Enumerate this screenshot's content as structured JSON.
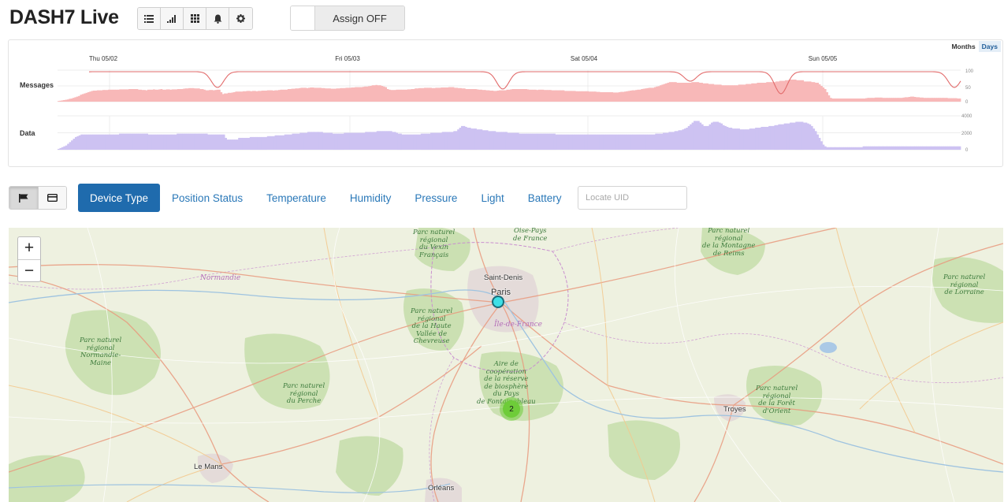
{
  "header": {
    "title": "DASH7 Live",
    "toolbar_icons": [
      "list-icon",
      "signal-icon",
      "grid-icon",
      "bell-icon",
      "gear-icon"
    ],
    "assign_label": "Assign OFF"
  },
  "chart": {
    "range_toggle": {
      "options": [
        "Months",
        "Days"
      ],
      "selected": "Days"
    },
    "day_labels": [
      "Thu 05/02",
      "Fri 05/03",
      "Sat 05/04",
      "Sun 05/05"
    ],
    "messages": {
      "label": "Messages",
      "ticks": [
        "100",
        "50",
        "0"
      ],
      "color": "#f8b8b8",
      "line_color": "#e26b6b"
    },
    "data": {
      "label": "Data",
      "ticks": [
        "4000",
        "2000",
        "0"
      ],
      "color": "#cdc2f2"
    }
  },
  "chart_data": [
    {
      "type": "bar",
      "name": "Messages",
      "x_labels": [
        "Thu 05/02",
        "Fri 05/03",
        "Sat 05/04",
        "Sun 05/05"
      ],
      "ylim": [
        0,
        100
      ],
      "values": [
        2,
        3,
        4,
        5,
        6,
        7,
        9,
        10,
        12,
        14,
        16,
        18,
        22,
        24,
        26,
        28,
        30,
        32,
        34,
        35,
        35,
        36,
        36,
        36,
        37,
        37,
        37,
        38,
        38,
        38,
        38,
        38,
        38,
        39,
        39,
        39,
        39,
        39,
        40,
        40,
        40,
        40,
        40,
        38,
        38,
        37,
        37,
        36,
        38,
        38,
        38,
        39,
        38,
        38,
        39,
        40,
        38,
        38,
        39,
        39,
        38,
        39,
        39,
        39,
        40,
        40,
        40,
        41,
        42,
        42,
        43,
        43,
        43,
        42,
        42,
        42,
        40,
        40,
        38,
        36,
        36,
        37,
        37,
        36,
        37,
        38,
        38,
        30,
        24,
        26,
        26,
        28,
        28,
        29,
        30,
        32,
        32,
        32,
        32,
        33,
        33,
        34,
        34,
        33,
        34,
        34,
        33,
        34,
        34,
        35,
        35,
        35,
        36,
        36,
        36,
        35,
        36,
        36,
        37,
        38,
        38,
        38,
        38,
        40,
        40,
        41,
        41,
        42,
        42,
        43,
        44,
        44,
        44,
        43,
        44,
        45,
        45,
        44,
        44,
        44,
        44,
        43,
        43,
        42,
        42,
        42,
        41,
        41,
        41,
        42,
        42,
        43,
        43,
        43,
        44,
        44,
        44,
        45,
        45,
        46,
        46,
        46,
        46,
        47,
        48,
        48,
        49,
        50,
        52,
        52,
        53,
        52,
        52,
        50,
        48,
        46,
        40,
        38,
        37,
        37,
        37,
        38,
        38,
        38,
        38,
        38,
        38,
        39,
        39,
        40,
        40,
        42,
        42,
        43,
        43,
        43,
        44,
        44,
        44,
        44,
        43,
        43,
        44,
        44,
        44,
        45,
        45,
        45,
        45,
        46,
        46,
        46,
        44,
        44,
        43,
        43,
        42,
        42,
        40,
        40,
        40,
        40,
        40,
        40,
        39,
        38,
        38,
        37,
        37,
        36,
        36,
        35,
        35,
        34,
        34,
        35,
        36,
        36,
        36,
        36,
        38,
        38,
        39,
        40,
        40,
        40,
        40,
        40,
        40,
        40,
        40,
        39,
        38,
        38,
        38,
        38,
        37,
        38,
        38,
        38,
        37,
        37,
        37,
        37,
        36,
        36,
        36,
        36,
        36,
        36,
        36,
        34,
        34,
        34,
        34,
        34,
        34,
        33,
        33,
        33,
        33,
        33,
        33,
        33,
        32,
        32,
        32,
        32,
        31,
        31,
        30,
        30,
        30,
        30,
        30,
        30,
        30,
        29,
        29,
        29,
        30,
        31,
        31,
        32,
        33,
        34,
        35,
        36,
        36,
        37,
        38,
        38,
        40,
        41,
        42,
        43,
        44,
        44,
        44,
        46,
        48,
        49,
        52,
        54,
        56,
        58,
        60,
        62,
        62,
        62,
        62,
        60,
        60,
        60,
        60,
        60,
        60,
        60,
        60,
        62,
        62,
        62,
        62,
        60,
        60,
        58,
        58,
        58,
        56,
        56,
        56,
        54,
        54,
        54,
        54,
        52,
        52,
        52,
        52,
        52,
        52,
        52,
        52,
        52,
        54,
        54,
        54,
        54,
        56,
        56,
        56,
        58,
        58,
        58,
        60,
        60,
        60,
        60,
        60,
        62,
        62,
        62,
        62,
        62,
        64,
        64,
        66,
        66,
        66,
        68,
        68,
        70,
        70,
        70,
        70,
        68,
        68,
        68,
        68,
        64,
        64,
        64,
        64,
        62,
        62,
        60,
        60,
        55,
        50,
        45,
        40,
        30,
        20,
        12,
        10,
        10,
        10,
        10,
        10,
        10,
        10,
        10,
        10,
        10,
        10,
        10,
        10,
        10,
        10,
        10,
        10,
        10,
        11,
        12,
        12,
        12,
        12,
        13,
        13,
        13,
        13,
        12,
        12,
        12,
        12,
        12,
        12,
        12,
        12,
        12,
        12,
        12,
        13,
        14,
        14,
        15,
        16,
        16,
        15,
        14,
        14,
        13,
        13,
        12,
        12,
        12,
        12,
        12,
        12,
        12,
        12,
        12,
        12,
        12,
        12,
        12,
        11,
        11,
        11,
        11,
        11,
        10,
        10
      ]
    },
    {
      "type": "bar",
      "name": "Data",
      "x_labels": [
        "Thu 05/02",
        "Fri 05/03",
        "Sat 05/04",
        "Sun 05/05"
      ],
      "ylim": [
        0,
        4000
      ],
      "values": [
        100,
        200,
        300,
        400,
        500,
        700,
        900,
        1100,
        1300,
        1500,
        1600,
        1700,
        1800,
        1800,
        1800,
        1800,
        1800,
        1800,
        1800,
        1800,
        1800,
        1800,
        1800,
        1800,
        1800,
        1800,
        1800,
        1800,
        1800,
        1800,
        1800,
        1800,
        1900,
        1900,
        1900,
        1900,
        1900,
        1900,
        1900,
        1900,
        1900,
        1900,
        1900,
        1900,
        1900,
        1900,
        1900,
        1800,
        1800,
        1800,
        1800,
        1800,
        1800,
        1800,
        1800,
        1800,
        1800,
        1800,
        1800,
        1800,
        1800,
        1800,
        1900,
        1900,
        1900,
        1900,
        1900,
        1900,
        1900,
        1900,
        1900,
        1900,
        1900,
        1900,
        1900,
        1900,
        1900,
        1900,
        1800,
        1800,
        1800,
        1800,
        1800,
        1800,
        1800,
        1800,
        1800,
        1400,
        1200,
        1200,
        1200,
        1200,
        1200,
        1200,
        1400,
        1400,
        1400,
        1400,
        1400,
        1400,
        1500,
        1500,
        1500,
        1500,
        1500,
        1500,
        1500,
        1500,
        1500,
        1600,
        1600,
        1600,
        1600,
        1700,
        1700,
        1700,
        1700,
        1700,
        1800,
        1800,
        1800,
        1800,
        1900,
        1900,
        1900,
        1900,
        2000,
        2000,
        2000,
        2000,
        2100,
        2100,
        2100,
        2100,
        2100,
        2100,
        2100,
        2100,
        2000,
        2000,
        2000,
        2000,
        2000,
        1900,
        1900,
        1900,
        1900,
        1900,
        1900,
        2000,
        2000,
        2000,
        2000,
        2000,
        2000,
        2000,
        2000,
        2000,
        2000,
        2000,
        2100,
        2100,
        2100,
        2100,
        2100,
        2100,
        2200,
        2200,
        2200,
        2200,
        2200,
        2200,
        2200,
        2200,
        2100,
        2100,
        2000,
        1900,
        1900,
        1800,
        1800,
        1800,
        1800,
        1800,
        1800,
        1800,
        1800,
        1800,
        1800,
        1900,
        1900,
        1900,
        1900,
        1900,
        2000,
        2000,
        2000,
        2000,
        2000,
        2000,
        2100,
        2100,
        2100,
        2100,
        2100,
        2100,
        2200,
        2200,
        2400,
        2600,
        2800,
        2800,
        2700,
        2600,
        2600,
        2500,
        2500,
        2500,
        2400,
        2400,
        2400,
        2300,
        2300,
        2300,
        2200,
        2200,
        2200,
        2200,
        2100,
        2100,
        2100,
        2100,
        2100,
        2100,
        2000,
        2000,
        2000,
        2000,
        2000,
        2000,
        1900,
        1900,
        1900,
        1900,
        1900,
        1900,
        1900,
        1900,
        1900,
        1900,
        1900,
        1900,
        1900,
        1900,
        1900,
        1900,
        1900,
        1900,
        1900,
        1800,
        1800,
        1800,
        1800,
        1800,
        1800,
        1800,
        1800,
        1800,
        1800,
        1800,
        1800,
        1800,
        1800,
        1800,
        1800,
        1800,
        1800,
        1800,
        1800,
        1800,
        1800,
        1800,
        1800,
        1800,
        1800,
        1800,
        1800,
        1800,
        1800,
        1800,
        1800,
        1800,
        1800,
        1800,
        1800,
        1800,
        1800,
        1800,
        1800,
        1800,
        1800,
        1800,
        1800,
        1800,
        1800,
        1800,
        1800,
        1800,
        1800,
        1800,
        1800,
        1900,
        1900,
        1900,
        1900,
        2000,
        2000,
        2000,
        2100,
        2100,
        2100,
        2200,
        2200,
        2300,
        2300,
        2400,
        2500,
        2600,
        2800,
        3000,
        3200,
        3400,
        3400,
        3400,
        3200,
        3000,
        2800,
        2800,
        2800,
        3000,
        3200,
        3300,
        3300,
        3300,
        3200,
        3100,
        2900,
        2800,
        2700,
        2600,
        2600,
        2500,
        2500,
        2500,
        2500,
        2400,
        2400,
        2400,
        2400,
        2400,
        2500,
        2500,
        2500,
        2600,
        2600,
        2600,
        2700,
        2700,
        2700,
        2700,
        2800,
        2800,
        2800,
        2900,
        2900,
        3000,
        3000,
        3000,
        3100,
        3100,
        3100,
        3200,
        3200,
        3200,
        3300,
        3300,
        3300,
        3300,
        3200,
        3200,
        3100,
        3000,
        2800,
        2500,
        2200,
        1800,
        1400,
        1000,
        600,
        400,
        300,
        300,
        300,
        300,
        300,
        300,
        300,
        300,
        300,
        300,
        300,
        300,
        300,
        300,
        300,
        300,
        300,
        300,
        300,
        400,
        400,
        400,
        400,
        400,
        400,
        400,
        400,
        400,
        400,
        400,
        400,
        400,
        400,
        400,
        400,
        400,
        400,
        400,
        400,
        400,
        400,
        400,
        400,
        400,
        400,
        400,
        400,
        400,
        400,
        400,
        400,
        400,
        400,
        400,
        400,
        400,
        400,
        400,
        400,
        400,
        400,
        400,
        400,
        400,
        400,
        400,
        400,
        400,
        400,
        400
      ]
    }
  ],
  "filter_bar": {
    "view_icons": [
      "flag-icon",
      "card-icon"
    ],
    "tabs": [
      "Device Type",
      "Position Status",
      "Temperature",
      "Humidity",
      "Pressure",
      "Light",
      "Battery"
    ],
    "active_tab": "Device Type",
    "locate_placeholder": "Locate UID"
  },
  "map": {
    "zoom_in": "+",
    "zoom_out": "−",
    "cluster_count": "2",
    "cluster_color": "#6ecc39",
    "marker_color": "#3ee0e6",
    "cities": {
      "paris": "Paris",
      "saint_denis": "Saint-Denis",
      "le_mans": "Le Mans",
      "orleans": "Orléans",
      "troyes": "Troyes",
      "ile_de_france": "Île-de-France",
      "normandie": "Normandie"
    },
    "parks": {
      "vexin": "Parc naturel\nrégional\ndu Vexin\nFrançais",
      "oise": "Oise-Pays\nde France",
      "reims": "Parc naturel\nrégional\nde la Montagne\nde Reims",
      "lorraine": "Parc naturel\nrégional\nde Lorraine",
      "chevreuse": "Parc naturel\nrégional\nde la Haute\nVallée de\nChevreuse",
      "biosphere": "Aire de\ncoopération\nde la réserve\nde biosphère\ndu Pays\nde Fontainebleau",
      "normandie_maine": "Parc naturel\nrégional\nNormandie-\nMaine",
      "perche": "Parc naturel\nrégional\ndu Perche",
      "orient": "Parc naturel\nrégional\nde la Forêt\nd'Orient"
    }
  }
}
